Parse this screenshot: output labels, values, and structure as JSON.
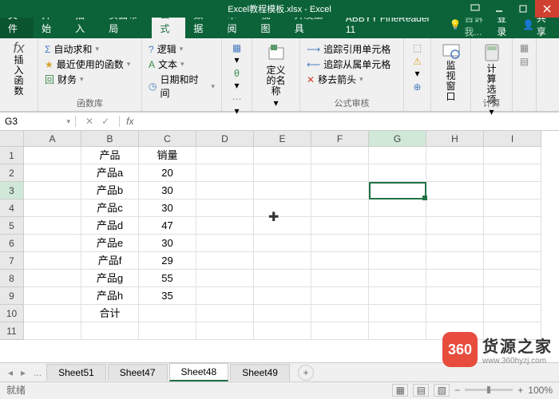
{
  "title": "Excel教程模板.xlsx - Excel",
  "tabs": {
    "file": "文件",
    "home": "开始",
    "insert": "插入",
    "layout": "页面布局",
    "formula": "公式",
    "data": "数据",
    "review": "审阅",
    "view": "视图",
    "dev": "开发工具",
    "abby": "ABBYY FineReader 11",
    "tell": "告诉我...",
    "login": "登录",
    "share": "共享"
  },
  "ribbon": {
    "insertfn": "插入函数",
    "autosum": "自动求和",
    "recent": "最近使用的函数",
    "finance": "财务",
    "logic": "逻辑",
    "text": "文本",
    "date": "日期和时间",
    "defname": "定义的名称",
    "trace1": "追踪引用单元格",
    "trace2": "追踪从属单元格",
    "arrows": "移去箭头",
    "watch": "监视窗口",
    "calc": "计算选项",
    "grp_fnlib": "函数库",
    "grp_audit": "公式审核",
    "grp_calc": "计算"
  },
  "namebox": "G3",
  "formulabar": "",
  "columns": [
    "A",
    "B",
    "C",
    "D",
    "E",
    "F",
    "G",
    "H",
    "I"
  ],
  "rowNums": [
    1,
    2,
    3,
    4,
    5,
    6,
    7,
    8,
    9,
    10,
    11
  ],
  "data": {
    "header": {
      "b": "产品",
      "c": "销量"
    },
    "rows": [
      {
        "b": "产品a",
        "c": "20"
      },
      {
        "b": "产品b",
        "c": "30"
      },
      {
        "b": "产品c",
        "c": "30"
      },
      {
        "b": "产品d",
        "c": "47"
      },
      {
        "b": "产品e",
        "c": "30"
      },
      {
        "b": "产品f",
        "c": "29"
      },
      {
        "b": "产品g",
        "c": "55"
      },
      {
        "b": "产品h",
        "c": "35"
      }
    ],
    "total": "合计"
  },
  "sheets": {
    "nav": "...",
    "s1": "Sheet51",
    "s2": "Sheet47",
    "s3": "Sheet48",
    "s4": "Sheet49"
  },
  "status": {
    "ready": "就绪",
    "zoom": "100%"
  },
  "watermark": {
    "icon": "360",
    "title": "货源之家",
    "url": "www.360hyzj.com"
  }
}
